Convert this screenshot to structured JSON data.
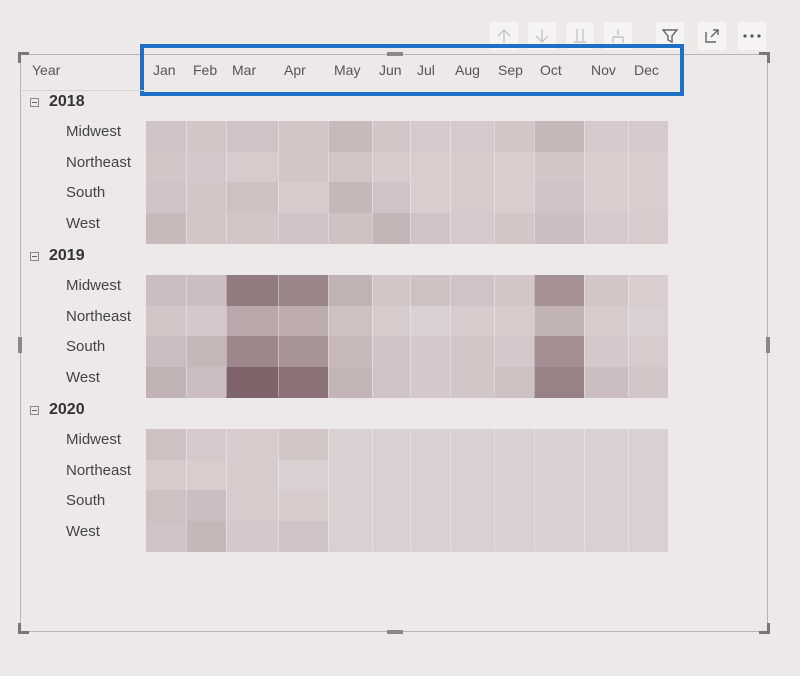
{
  "matrix": {
    "year_header": "Year",
    "months": [
      "Jan",
      "Feb",
      "Mar",
      "Apr",
      "May",
      "Jun",
      "Jul",
      "Aug",
      "Sep",
      "Oct",
      "Nov",
      "Dec"
    ],
    "groups": [
      {
        "year": "2018",
        "rows": [
          {
            "region": "Midwest",
            "levels": [
              0.2,
              0.18,
              0.2,
              0.18,
              0.28,
              0.18,
              0.15,
              0.15,
              0.18,
              0.3,
              0.15,
              0.15
            ]
          },
          {
            "region": "Northeast",
            "levels": [
              0.18,
              0.16,
              0.14,
              0.18,
              0.18,
              0.14,
              0.12,
              0.14,
              0.12,
              0.18,
              0.12,
              0.12
            ]
          },
          {
            "region": "South",
            "levels": [
              0.2,
              0.18,
              0.22,
              0.14,
              0.3,
              0.2,
              0.12,
              0.14,
              0.12,
              0.2,
              0.12,
              0.12
            ]
          },
          {
            "region": "West",
            "levels": [
              0.28,
              0.18,
              0.18,
              0.2,
              0.22,
              0.32,
              0.2,
              0.15,
              0.18,
              0.24,
              0.15,
              0.14
            ]
          }
        ]
      },
      {
        "year": "2019",
        "rows": [
          {
            "region": "Midwest",
            "levels": [
              0.25,
              0.24,
              0.78,
              0.7,
              0.34,
              0.18,
              0.22,
              0.2,
              0.18,
              0.6,
              0.18,
              0.12
            ]
          },
          {
            "region": "Northeast",
            "levels": [
              0.18,
              0.16,
              0.42,
              0.38,
              0.22,
              0.14,
              0.1,
              0.14,
              0.14,
              0.34,
              0.14,
              0.1
            ]
          },
          {
            "region": "South",
            "levels": [
              0.25,
              0.3,
              0.68,
              0.58,
              0.28,
              0.2,
              0.16,
              0.18,
              0.16,
              0.62,
              0.16,
              0.14
            ]
          },
          {
            "region": "West",
            "levels": [
              0.34,
              0.24,
              0.95,
              0.85,
              0.32,
              0.2,
              0.16,
              0.18,
              0.22,
              0.72,
              0.24,
              0.18
            ]
          }
        ]
      },
      {
        "year": "2020",
        "rows": [
          {
            "region": "Midwest",
            "levels": [
              0.22,
              0.15,
              0.14,
              0.18,
              0.1,
              0.1,
              0.1,
              0.1,
              0.1,
              0.1,
              0.1,
              0.1
            ]
          },
          {
            "region": "Northeast",
            "levels": [
              0.14,
              0.12,
              0.14,
              0.1,
              0.1,
              0.1,
              0.1,
              0.1,
              0.1,
              0.1,
              0.1,
              0.1
            ]
          },
          {
            "region": "South",
            "levels": [
              0.22,
              0.24,
              0.14,
              0.14,
              0.1,
              0.1,
              0.1,
              0.1,
              0.1,
              0.1,
              0.1,
              0.1
            ]
          },
          {
            "region": "West",
            "levels": [
              0.2,
              0.3,
              0.16,
              0.2,
              0.1,
              0.1,
              0.1,
              0.1,
              0.1,
              0.1,
              0.1,
              0.1
            ]
          }
        ]
      }
    ],
    "color_low": "#e6dcdd",
    "color_high": "#7a5f64"
  },
  "highlight_color": "#1f6fc4",
  "toolbar": {
    "icons": [
      "drill-up-icon",
      "drill-down-icon",
      "expand-all-icon",
      "drill-hierarchy-icon",
      "filter-icon",
      "focus-mode-icon",
      "more-options-icon"
    ]
  }
}
